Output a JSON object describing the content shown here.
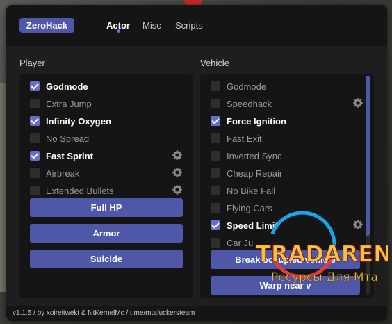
{
  "brand": "ZeroHack",
  "tabs": [
    {
      "label": "Actor",
      "active": true
    },
    {
      "label": "Misc",
      "active": false
    },
    {
      "label": "Scripts",
      "active": false
    }
  ],
  "player": {
    "title": "Player",
    "items": [
      {
        "label": "Godmode",
        "checked": true,
        "gear": false
      },
      {
        "label": "Extra Jump",
        "checked": false,
        "gear": false
      },
      {
        "label": "Infinity Oxygen",
        "checked": true,
        "gear": false
      },
      {
        "label": "No Spread",
        "checked": false,
        "gear": false
      },
      {
        "label": "Fast Sprint",
        "checked": true,
        "gear": true
      },
      {
        "label": "Airbreak",
        "checked": false,
        "gear": true
      },
      {
        "label": "Extended Bullets",
        "checked": false,
        "gear": true
      }
    ],
    "buttons": [
      "Full HP",
      "Armor",
      "Suicide"
    ]
  },
  "vehicle": {
    "title": "Vehicle",
    "items": [
      {
        "label": "Godmode",
        "checked": false,
        "gear": false
      },
      {
        "label": "Speedhack",
        "checked": false,
        "gear": true
      },
      {
        "label": "Force Ignition",
        "checked": true,
        "gear": false
      },
      {
        "label": "Fast Exit",
        "checked": false,
        "gear": false
      },
      {
        "label": "Inverted Sync",
        "checked": false,
        "gear": false
      },
      {
        "label": "Cheap Repair",
        "checked": false,
        "gear": false
      },
      {
        "label": "No Bike Fall",
        "checked": false,
        "gear": false
      },
      {
        "label": "Flying Cars",
        "checked": false,
        "gear": false
      },
      {
        "label": "Speed Limit",
        "checked": true,
        "gear": true
      },
      {
        "label": "Car Ju",
        "checked": false,
        "gear": false
      }
    ],
    "buttons": [
      "Break occupied vehicle",
      "Warp near v"
    ]
  },
  "footer": "v1.1.5 / by xoireitwekt & NtKernelMc / t.me/mtafuckersteam",
  "watermark": {
    "line1": "TRADARENA",
    "line2": "Ресурсы Для Мта"
  },
  "colors": {
    "accent": "#4f57a8",
    "checkbox_on": "#6670c6",
    "window_bg": "#151515",
    "content_bg": "#1e1e1e"
  }
}
